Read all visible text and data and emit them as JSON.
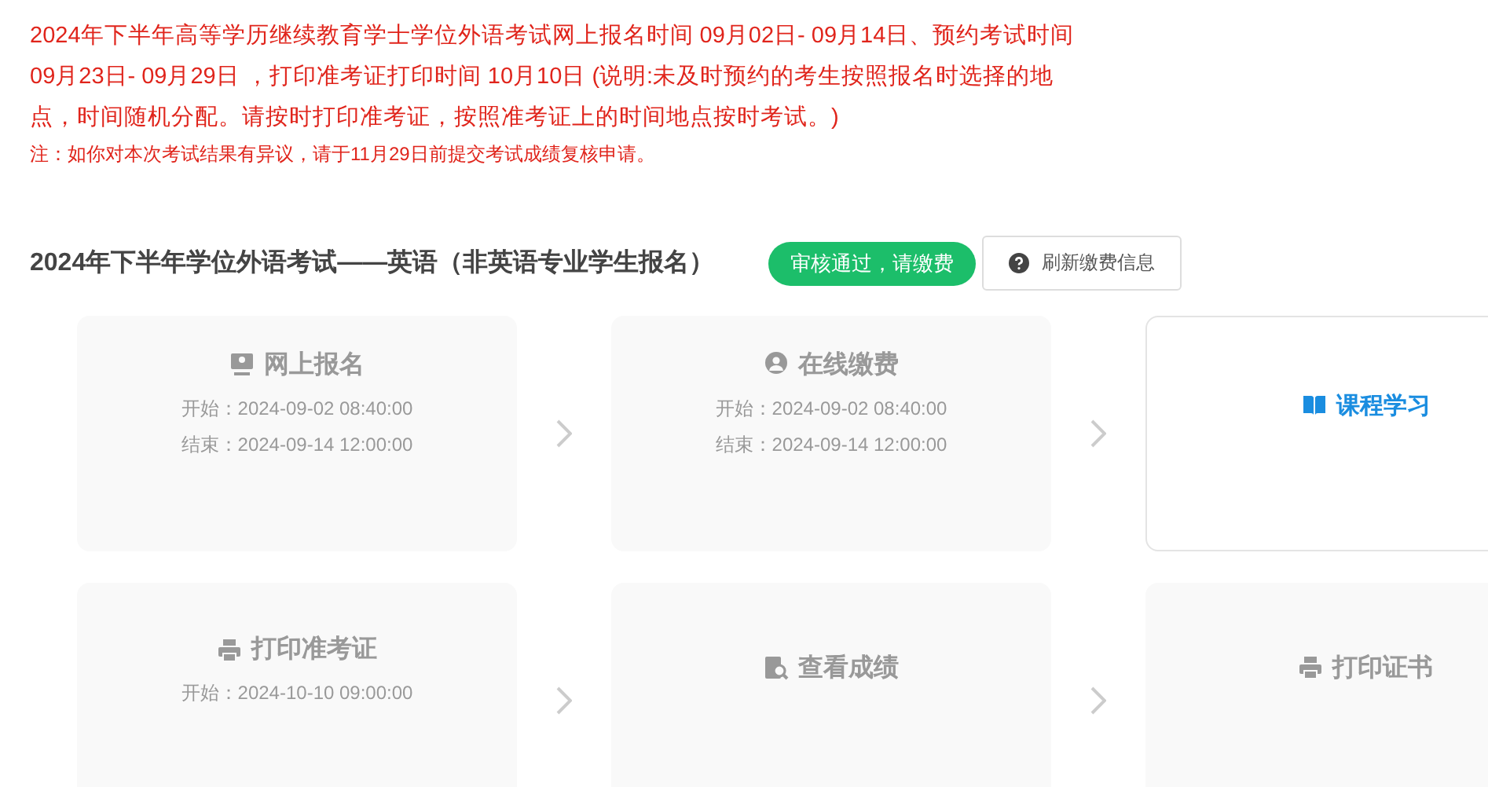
{
  "notice": {
    "text": "2024年下半年高等学历继续教育学士学位外语考试网上报名时间 09月02日- 09月14日、预约考试时间 09月23日- 09月29日 ，打印准考证打印时间 10月10日 (说明:未及时预约的考生按照报名时选择的地点，时间随机分配。请按时打印准考证，按照准考证上的时间地点按时考试。)",
    "note": "注：如你对本次考试结果有异议，请于11月29日前提交考试成绩复核申请。"
  },
  "exam": {
    "title": "2024年下半年学位外语考试——英语（非英语专业学生报名）",
    "status": "审核通过，请缴费",
    "refresh_button": "刷新缴费信息"
  },
  "steps": [
    {
      "title": "网上报名",
      "active": false,
      "lines": [
        "开始：2024-09-02 08:40:00",
        "结束：2024-09-14 12:00:00"
      ]
    },
    {
      "title": "在线缴费",
      "active": false,
      "lines": [
        "开始：2024-09-02 08:40:00",
        "结束：2024-09-14 12:00:00"
      ]
    },
    {
      "title": "课程学习",
      "active": true
    },
    {
      "title": "打印准考证",
      "active": false,
      "lines": [
        "开始：2024-10-10 09:00:00"
      ]
    },
    {
      "title": "查看成绩",
      "active": false
    },
    {
      "title": "打印证书",
      "active": false
    }
  ]
}
